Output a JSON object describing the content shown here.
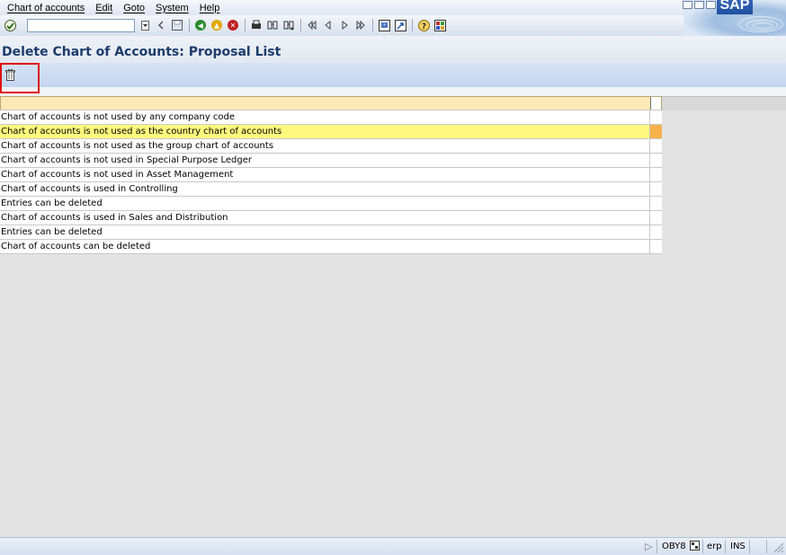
{
  "menu": {
    "items": [
      "Chart of accounts",
      "Edit",
      "Goto",
      "System",
      "Help"
    ]
  },
  "logo": {
    "text": "SAP"
  },
  "toolbar": {
    "command_field_value": "",
    "icons": [
      "enter-icon",
      "command-field-dropdown-icon",
      "back-arrow-icon",
      "save-icon",
      "back-icon",
      "exit-icon",
      "cancel-icon",
      "print-icon",
      "find-icon",
      "find-next-icon",
      "first-page-icon",
      "previous-page-icon",
      "next-page-icon",
      "last-page-icon",
      "create-session-icon",
      "shortcut-icon",
      "help-icon",
      "customize-layout-icon"
    ]
  },
  "page": {
    "title": "Delete Chart of Accounts: Proposal List"
  },
  "app_toolbar": {
    "delete_icon": "trash-icon"
  },
  "table": {
    "header": "",
    "rows": [
      "Chart of accounts is not used by any company code",
      "Chart of accounts is not used as the country chart of accounts",
      "Chart of accounts is not used as the group chart of accounts",
      "Chart of accounts is not used in Special Purpose Ledger",
      "Chart of accounts is not used in Asset Management",
      "Chart of accounts is used in Controlling",
      "Entries can be deleted",
      "Chart of accounts is used in Sales and Distribution",
      "Entries can be deleted",
      "Chart of accounts can be deleted"
    ],
    "highlight_row": 1
  },
  "status": {
    "transaction": "OBY8",
    "system": "erp",
    "mode": "INS"
  },
  "colors": {
    "title": "#1c3c6b",
    "highlight_row": "#fef97e",
    "header_row": "#fde9b6",
    "appbar": "#c3d5ef",
    "delete_highlight": "#e01010"
  }
}
